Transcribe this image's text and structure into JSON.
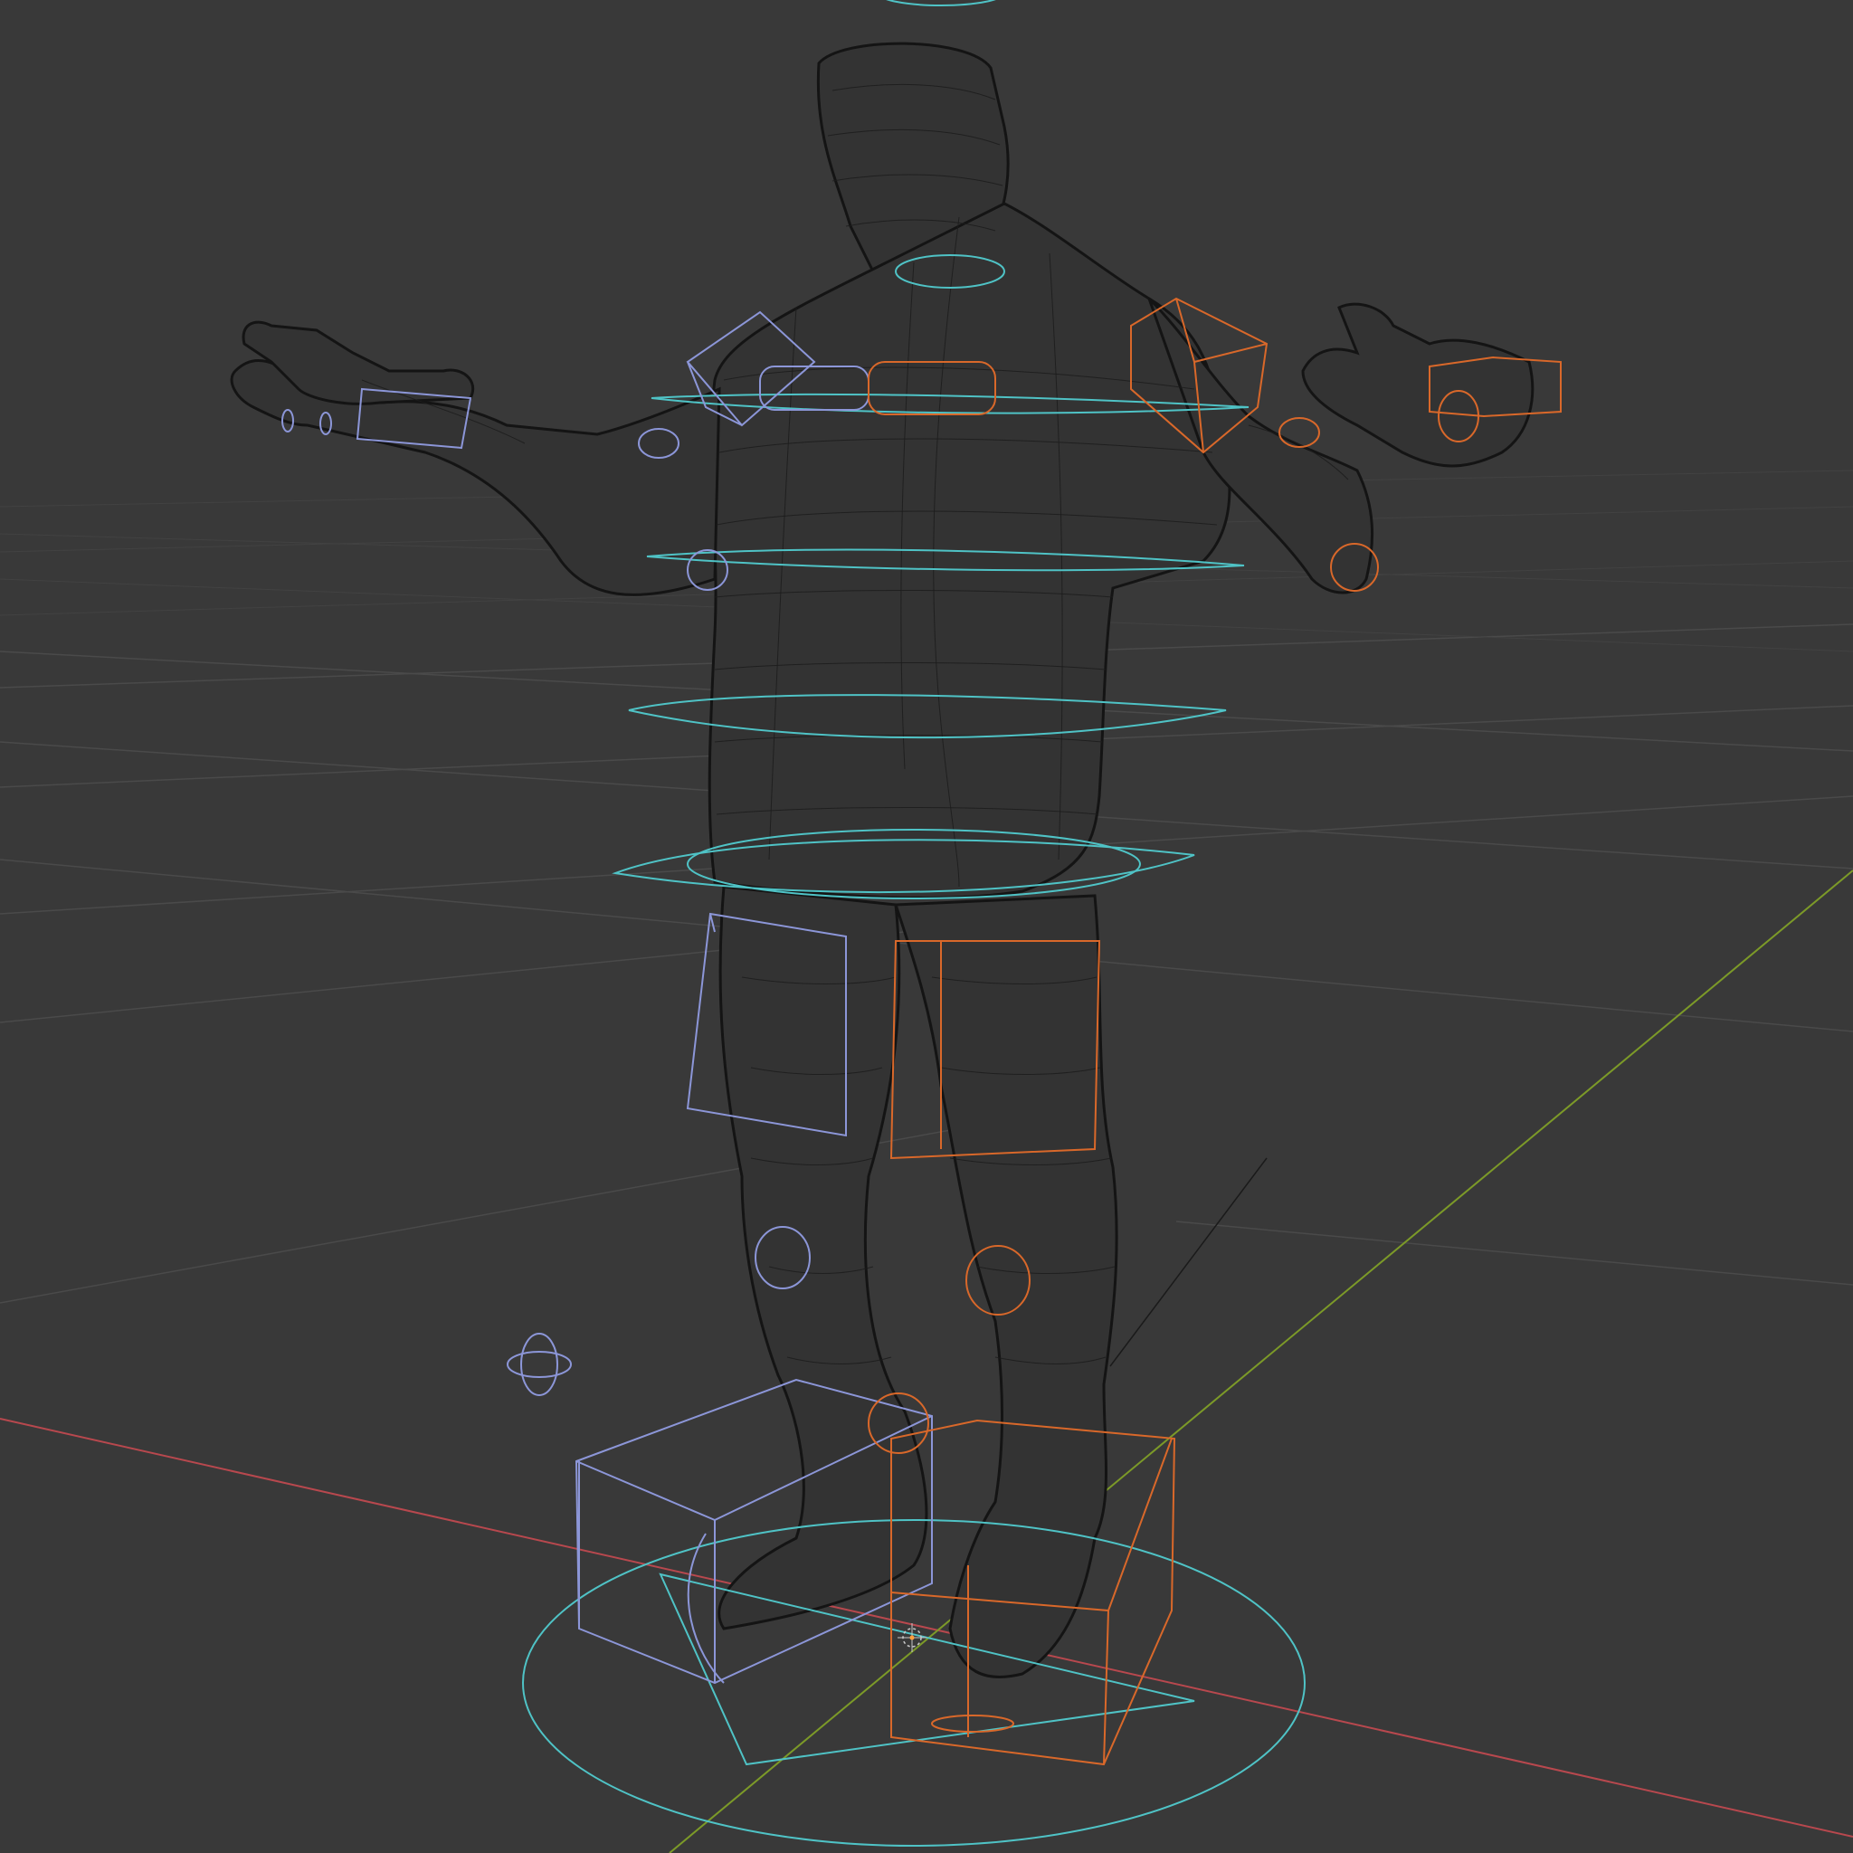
{
  "viewport": {
    "background": "#393939",
    "grid_color": "#4a4a4a",
    "axis_x_color": "#b8484e",
    "axis_y_color": "#7c9a28",
    "mesh_wire_color": "#1c1c1c",
    "controls_center_color": "#4fc3c6",
    "controls_left_color": "#8c96d8",
    "controls_right_color": "#d9682a",
    "cursor_icon": "3d-cursor-icon"
  }
}
